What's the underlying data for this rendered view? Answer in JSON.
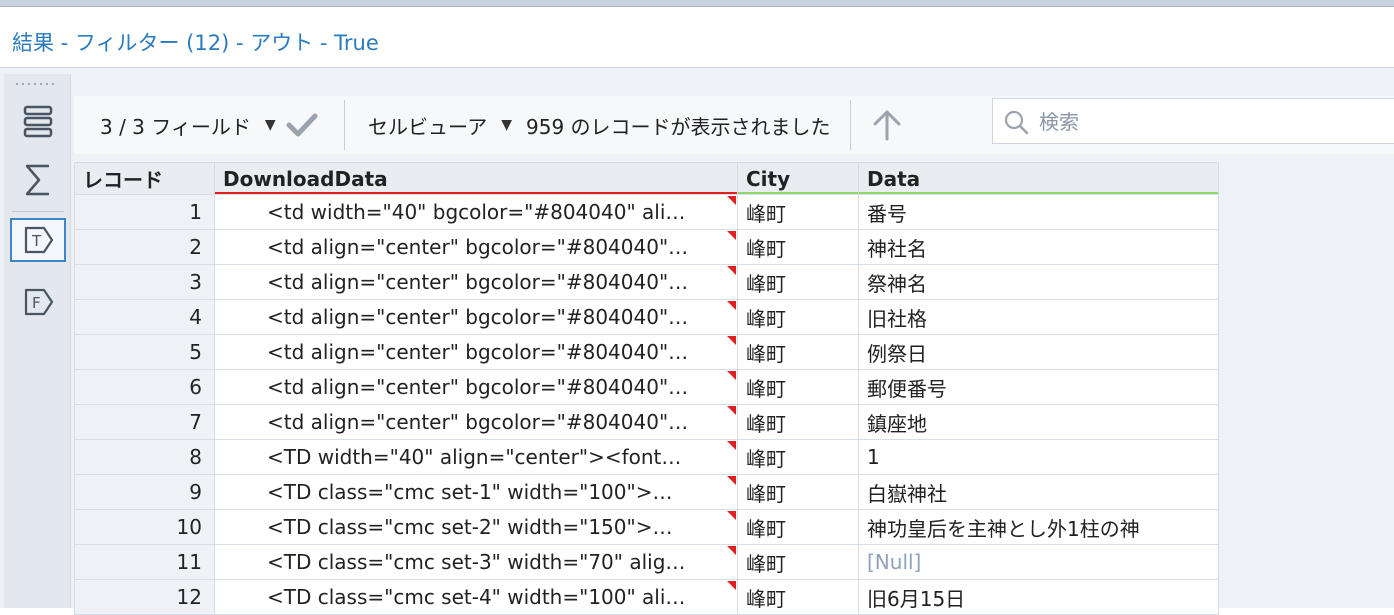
{
  "window": {
    "title": "結果 - フィルター (12) - アウト - True"
  },
  "toolbar": {
    "fields_label": "3 / 3 フィールド",
    "viewer_label": "セルビューア",
    "record_count_text": "959 のレコードが表示されました",
    "search_placeholder": "検索"
  },
  "table": {
    "headers": {
      "record": "レコード",
      "download": "DownloadData",
      "city": "City",
      "data": "Data"
    },
    "header_underline_colors": {
      "download": "#e02020",
      "city": "#8fd86b",
      "data": "#8fd86b"
    },
    "rows": [
      {
        "rec": "1",
        "download": "<td width=\"40\" bgcolor=\"#804040\" ali…",
        "city": "峰町",
        "data": "番号"
      },
      {
        "rec": "2",
        "download": "<td align=\"center\" bgcolor=\"#804040\"…",
        "city": "峰町",
        "data": "神社名"
      },
      {
        "rec": "3",
        "download": "<td align=\"center\" bgcolor=\"#804040\"…",
        "city": "峰町",
        "data": "祭神名"
      },
      {
        "rec": "4",
        "download": "<td align=\"center\" bgcolor=\"#804040\"…",
        "city": "峰町",
        "data": "旧社格"
      },
      {
        "rec": "5",
        "download": "<td align=\"center\" bgcolor=\"#804040\"…",
        "city": "峰町",
        "data": "例祭日"
      },
      {
        "rec": "6",
        "download": "<td align=\"center\" bgcolor=\"#804040\"…",
        "city": "峰町",
        "data": "郵便番号"
      },
      {
        "rec": "7",
        "download": "<td align=\"center\" bgcolor=\"#804040\"…",
        "city": "峰町",
        "data": "鎮座地"
      },
      {
        "rec": "8",
        "download": "<TD width=\"40\" align=\"center\"><font…",
        "city": "峰町",
        "data": "1"
      },
      {
        "rec": "9",
        "download": "<TD class=\"cmc set-1\" width=\"100\">…",
        "city": "峰町",
        "data": "白嶽神社"
      },
      {
        "rec": "10",
        "download": "<TD class=\"cmc set-2\" width=\"150\">…",
        "city": "峰町",
        "data": "神功皇后を主神とし外1柱の神"
      },
      {
        "rec": "11",
        "download": "<TD class=\"cmc set-3\" width=\"70\" alig…",
        "city": "峰町",
        "data": "[Null]"
      },
      {
        "rec": "12",
        "download": "<TD class=\"cmc set-4\" width=\"100\" ali…",
        "city": "峰町",
        "data": "旧6月15日"
      }
    ]
  }
}
